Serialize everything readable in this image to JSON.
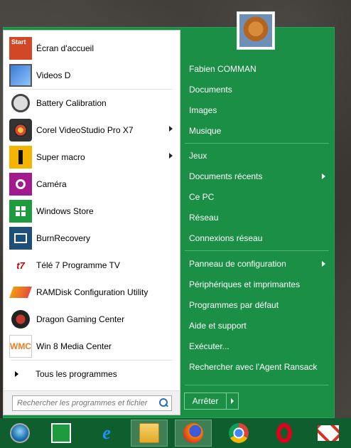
{
  "colors": {
    "menu_green": "#1a8f45",
    "taskbar_green": "#0e5f2d",
    "left_pane_bg": "#ffffff"
  },
  "user": {
    "name": "Fabien COMMAN",
    "avatar_icon": "cat-photo-avatar"
  },
  "programs": [
    {
      "label": "Écran d'accueil",
      "icon": "start-screen-icon",
      "has_submenu": false
    },
    {
      "label": "Videos D",
      "icon": "video-folder-icon",
      "has_submenu": false
    },
    {
      "label": "Battery Calibration",
      "icon": "battery-calibration-icon",
      "has_submenu": false
    },
    {
      "label": "Corel VideoStudio Pro X7",
      "icon": "corel-videostudio-icon",
      "has_submenu": true
    },
    {
      "label": "Super macro",
      "icon": "super-macro-icon",
      "has_submenu": true
    },
    {
      "label": "Caméra",
      "icon": "camera-icon",
      "has_submenu": false
    },
    {
      "label": "Windows Store",
      "icon": "windows-store-icon",
      "has_submenu": false
    },
    {
      "label": "BurnRecovery",
      "icon": "burnrecovery-icon",
      "has_submenu": false
    },
    {
      "label": "Télé 7 Programme TV",
      "icon": "tele7-icon",
      "has_submenu": false
    },
    {
      "label": "RAMDisk Configuration Utility",
      "icon": "ramdisk-icon",
      "has_submenu": false
    },
    {
      "label": "Dragon Gaming Center",
      "icon": "dragon-gaming-icon",
      "has_submenu": false
    },
    {
      "label": "Win 8 Media Center",
      "icon": "media-center-icon",
      "has_submenu": false
    }
  ],
  "start_tile_text": "Start",
  "all_programs_label": "Tous les programmes",
  "search": {
    "placeholder": "Rechercher les programmes et fichier"
  },
  "right_items": [
    {
      "label": "Fabien COMMAN",
      "has_submenu": false
    },
    {
      "label": "Documents",
      "has_submenu": false
    },
    {
      "label": "Images",
      "has_submenu": false
    },
    {
      "label": "Musique",
      "has_submenu": false
    },
    {
      "label": "Jeux",
      "has_submenu": false
    },
    {
      "label": "Documents récents",
      "has_submenu": true
    },
    {
      "label": "Ce PC",
      "has_submenu": false
    },
    {
      "label": "Réseau",
      "has_submenu": false
    },
    {
      "label": "Connexions réseau",
      "has_submenu": false
    },
    {
      "label": "Panneau de configuration",
      "has_submenu": true
    },
    {
      "label": "Périphériques et imprimantes",
      "has_submenu": false
    },
    {
      "label": "Programmes par défaut",
      "has_submenu": false
    },
    {
      "label": "Aide et support",
      "has_submenu": false
    },
    {
      "label": "Exécuter...",
      "has_submenu": false
    },
    {
      "label": "Rechercher avec l'Agent Ransack",
      "has_submenu": false
    }
  ],
  "shutdown_label": "Arrêter",
  "taskbar": [
    {
      "icon": "start-orb-icon",
      "active": false
    },
    {
      "icon": "windows-store-icon",
      "active": false
    },
    {
      "icon": "internet-explorer-icon",
      "active": false
    },
    {
      "icon": "file-explorer-icon",
      "active": true
    },
    {
      "icon": "firefox-icon",
      "active": true
    },
    {
      "icon": "chrome-icon",
      "active": false
    },
    {
      "icon": "opera-icon",
      "active": false
    },
    {
      "icon": "gmail-icon",
      "active": false
    }
  ]
}
